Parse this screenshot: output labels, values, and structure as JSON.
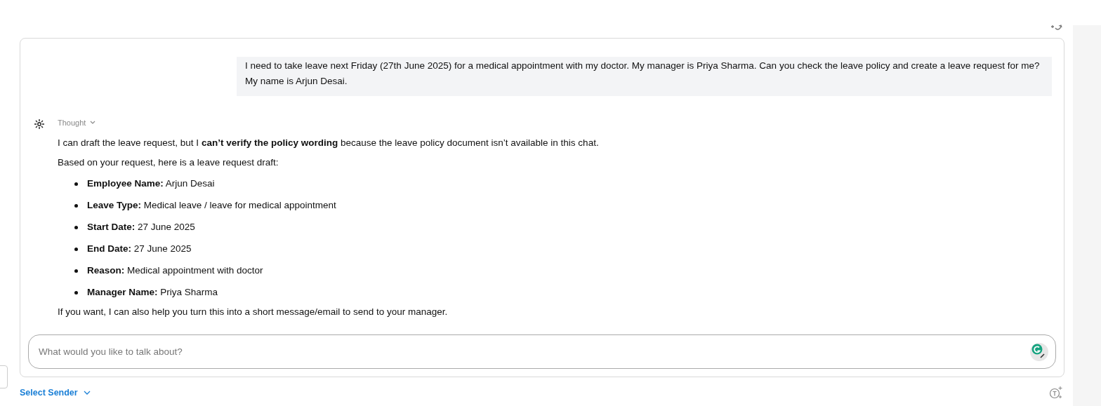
{
  "user_message": "I need to take leave next Friday (27th June 2025) for a medical appointment with my doctor. My manager is Priya Sharma. Can you check the leave policy and create a leave request for me? My name is Arjun Desai.",
  "assistant": {
    "thought_label": "Thought",
    "thought_expanded": false,
    "intro": "I can draft the leave request, but I **can’t verify the policy wording** because the leave policy document isn’t available in this chat.",
    "lead": "Based on your request, here is a leave request draft:",
    "items": [
      {
        "label": "Employee Name:",
        "value": "Arjun Desai"
      },
      {
        "label": "Leave Type:",
        "value": "Medical leave / leave for medical appointment"
      },
      {
        "label": "Start Date:",
        "value": "27 June 2025"
      },
      {
        "label": "End Date:",
        "value": "27 June 2025"
      },
      {
        "label": "Reason:",
        "value": "Medical appointment with doctor"
      },
      {
        "label": "Manager Name:",
        "value": "Priya Sharma"
      }
    ],
    "closing": "If you want, I can also help you turn this into a short message/email to send to your manager."
  },
  "composer": {
    "placeholder": "What would you like to talk about?"
  },
  "sender_select": {
    "label": "Select Sender"
  }
}
